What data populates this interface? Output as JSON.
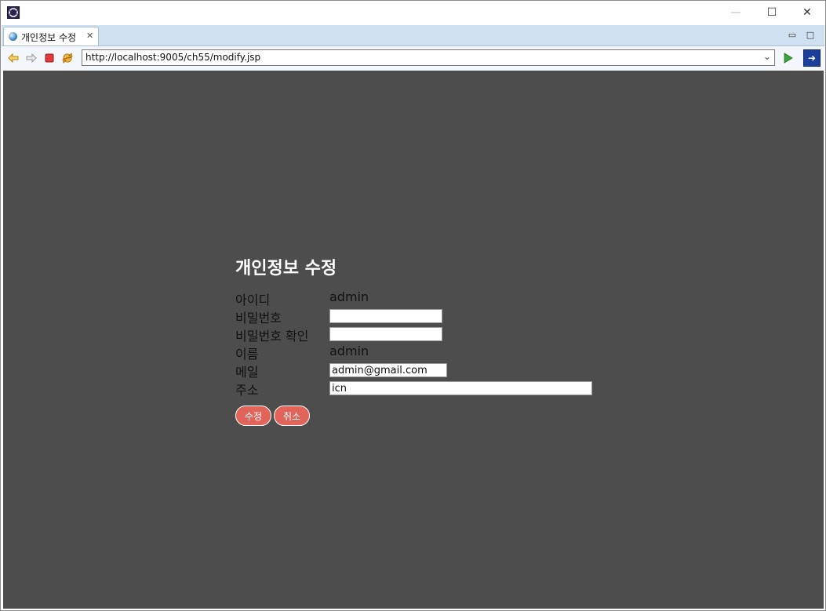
{
  "window": {
    "tab_title": "개인정보 수정",
    "minimize_glyph": "—",
    "maximize_glyph": "☐",
    "close_glyph": "✕"
  },
  "toolbar": {
    "url": "http://localhost:9005/ch55/modify.jsp"
  },
  "form": {
    "heading": "개인정보 수정",
    "id_label": "아이디",
    "id_value": "admin",
    "password_label": "비밀번호",
    "password_value": "",
    "password_confirm_label": "비밀번호 확인",
    "password_confirm_value": "",
    "name_label": "이름",
    "name_value": "admin",
    "email_label": "메일",
    "email_value": "admin@gmail.com",
    "address_label": "주소",
    "address_value": "icn",
    "submit_label": "수정",
    "cancel_label": "취소"
  },
  "colors": {
    "content_bg": "#4d4d4d",
    "button_bg": "#e0645a",
    "tabbar_bg": "#cfe0f0"
  }
}
